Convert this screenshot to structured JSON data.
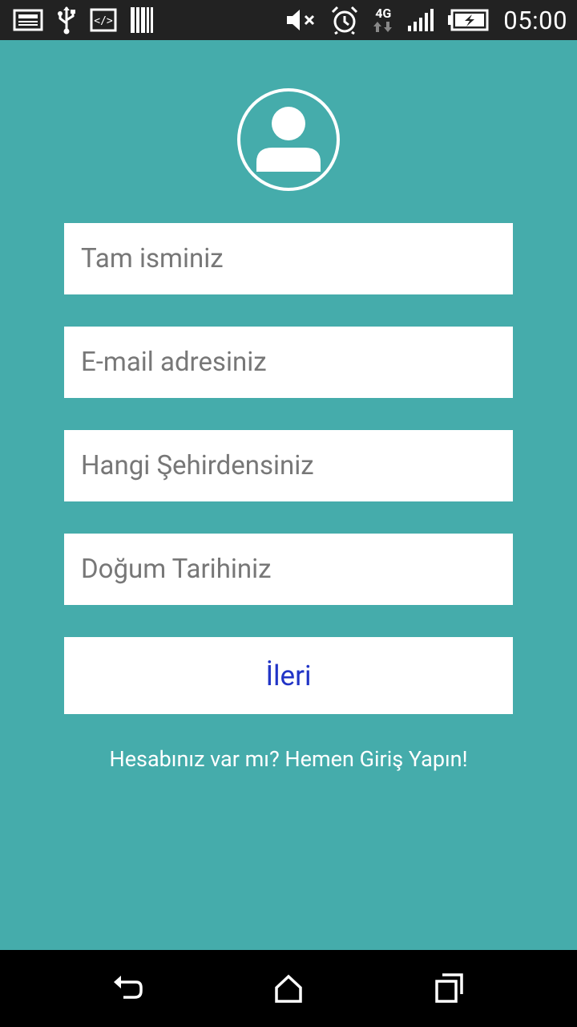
{
  "status_bar": {
    "time": "05:00",
    "network": "4G",
    "left_icons": [
      "screenshot-icon",
      "usb-icon",
      "code-icon",
      "barcode-icon"
    ],
    "right_icons": [
      "mute-icon",
      "alarm-icon",
      "data-arrows-icon",
      "signal-icon",
      "battery-charging-icon"
    ]
  },
  "form": {
    "avatar_icon": "user-avatar-icon",
    "full_name": {
      "placeholder": "Tam isminiz",
      "value": ""
    },
    "email": {
      "placeholder": "E-mail adresiniz",
      "value": ""
    },
    "city": {
      "placeholder": "Hangi Şehirdensiniz",
      "value": ""
    },
    "birth_date": {
      "placeholder": "Doğum Tarihiniz",
      "value": ""
    },
    "next_label": "İleri",
    "login_link": "Hesabınız var mı? Hemen Giriş Yapın!"
  },
  "nav_bar": {
    "buttons": [
      "back-icon",
      "home-icon",
      "recent-apps-icon"
    ]
  },
  "colors": {
    "background": "#45ACAB",
    "status_bar": "#222222",
    "nav_bar": "#000000",
    "button_text": "#2134C6",
    "placeholder": "#777777"
  }
}
